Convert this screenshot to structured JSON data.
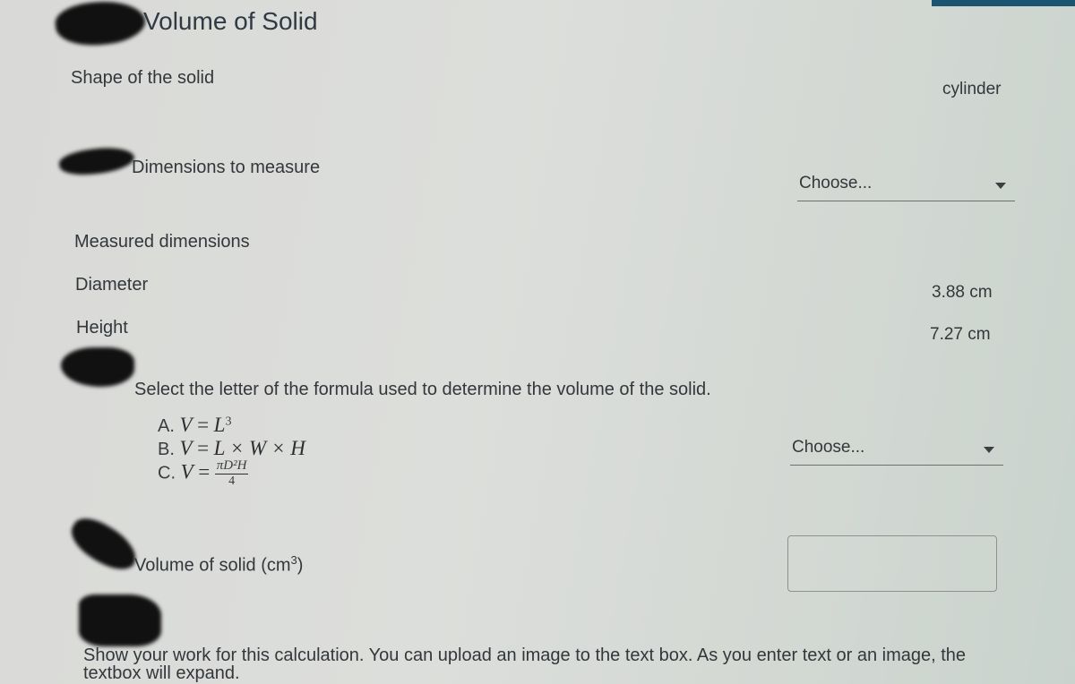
{
  "header": {
    "title": "Volume of Solid"
  },
  "shape": {
    "label": "Shape of the solid",
    "value": "cylinder"
  },
  "dimensions": {
    "label": "Dimensions to measure",
    "select_value": "Choose..."
  },
  "measured": {
    "heading": "Measured dimensions",
    "rows": [
      {
        "label": "Diameter",
        "value": "3.88 cm"
      },
      {
        "label": "Height",
        "value": "7.27 cm"
      }
    ]
  },
  "formula_question": {
    "prompt": "Select the letter of the formula used to determine the volume of the solid.",
    "options": [
      {
        "letter": "A.",
        "lhs": "V",
        "eq": "=",
        "rhs": "L",
        "sup": "3"
      },
      {
        "letter": "B.",
        "lhs": "V",
        "eq": "=",
        "rhs": "L × W × H"
      },
      {
        "letter": "C.",
        "lhs": "V",
        "eq": "=",
        "numerator": "πD²H",
        "denominator": "4"
      }
    ],
    "select_value": "Choose..."
  },
  "volume": {
    "label_prefix": "Volume of solid (cm",
    "label_sup": "3",
    "label_suffix": ")",
    "input_value": ""
  },
  "work": {
    "instructions_line1": "Show your work for this calculation. You can upload an image to the text box. As you enter text or an image, the",
    "instructions_line2": "textbox will expand."
  },
  "colors": {
    "accent_bar": "#1b5470"
  }
}
